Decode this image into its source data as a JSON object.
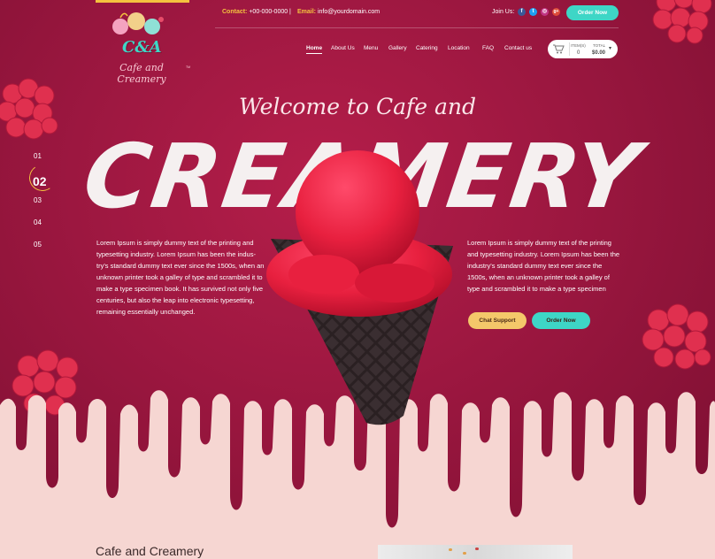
{
  "logo": {
    "monogram": "C&A",
    "name": "Cafe and Creamery",
    "tm": "TM"
  },
  "topbar": {
    "contact_key": "Contact:",
    "contact_value": "+00-000-0000",
    "divider": "|",
    "email_key": "Email:",
    "email_value": "info@yourdomain.com",
    "join_label": "Join Us:",
    "social": [
      {
        "name": "facebook-icon",
        "glyph": "f",
        "color": "#3b5998"
      },
      {
        "name": "twitter-icon",
        "glyph": "t",
        "color": "#1da1f2"
      },
      {
        "name": "instagram-icon",
        "glyph": "◎",
        "color": "#c13584"
      },
      {
        "name": "google-plus-icon",
        "glyph": "g+",
        "color": "#dd4b39"
      }
    ],
    "order_button": "Order Now"
  },
  "nav": [
    "Home",
    "About Us",
    "Menu",
    "Gallery",
    "Catering",
    "Location",
    "FAQ",
    "Contact us"
  ],
  "cart": {
    "items_label": "ITEM(S)",
    "items_value": "0",
    "total_label": "TOTAL",
    "total_value": "$0.00",
    "caret": "▾"
  },
  "hero": {
    "welcome": "Welcome to Cafe and",
    "headline": "CREAMERY",
    "slides": [
      "01",
      "02",
      "03",
      "04",
      "05"
    ],
    "current_slide": "02",
    "left_text": "Lorem Ipsum is simply dummy text of the printing and typesetting industry. Lorem Ipsum has been the indus- try's standard dummy text ever since the 1500s, when an unknown printer took a galley of type and scrambled it to make a type specimen book. It has survived not only five centuries, but also the leap into electronic typesetting, remaining essentially unchanged.",
    "right_text": "Lorem Ipsum is simply dummy text of the printing and typesetting industry. Lorem Ipsum has been the industry's standard dummy text ever since the 1500s, when an unknown printer took a galley of type and scrambled it to make a type specimen",
    "chat_button": "Chat Support",
    "order_button": "Order Now"
  },
  "section": {
    "title": "Cafe and Creamery"
  },
  "colors": {
    "brand": "#9c1740",
    "accent_yellow": "#f4c23f",
    "accent_teal": "#3ed6c6",
    "cream": "#f6d6d2"
  }
}
